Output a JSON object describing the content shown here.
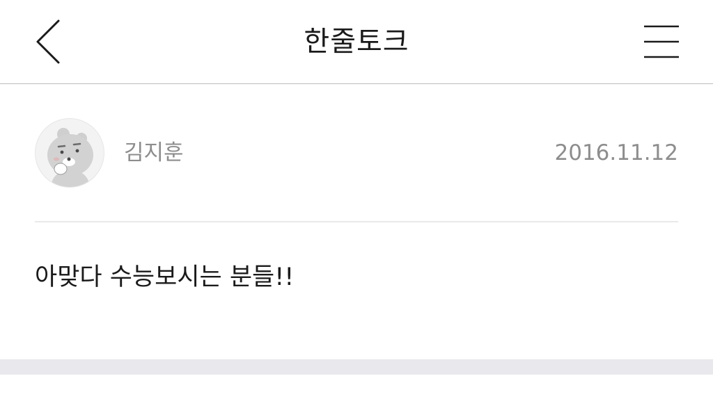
{
  "header": {
    "title": "한줄토크",
    "back_icon": "chevron-left-icon",
    "menu_icon": "hamburger-menu-icon"
  },
  "post": {
    "author": "김지훈",
    "date": "2016.11.12",
    "avatar_icon": "lion-character-avatar",
    "content": "아맞다 수능보시는 분들!!"
  },
  "colors": {
    "background": "#ffffff",
    "title_text": "#1a1a1a",
    "meta_text": "#8d8d8d",
    "divider": "#e9e9e9",
    "footer_band": "#e8e8ed"
  }
}
